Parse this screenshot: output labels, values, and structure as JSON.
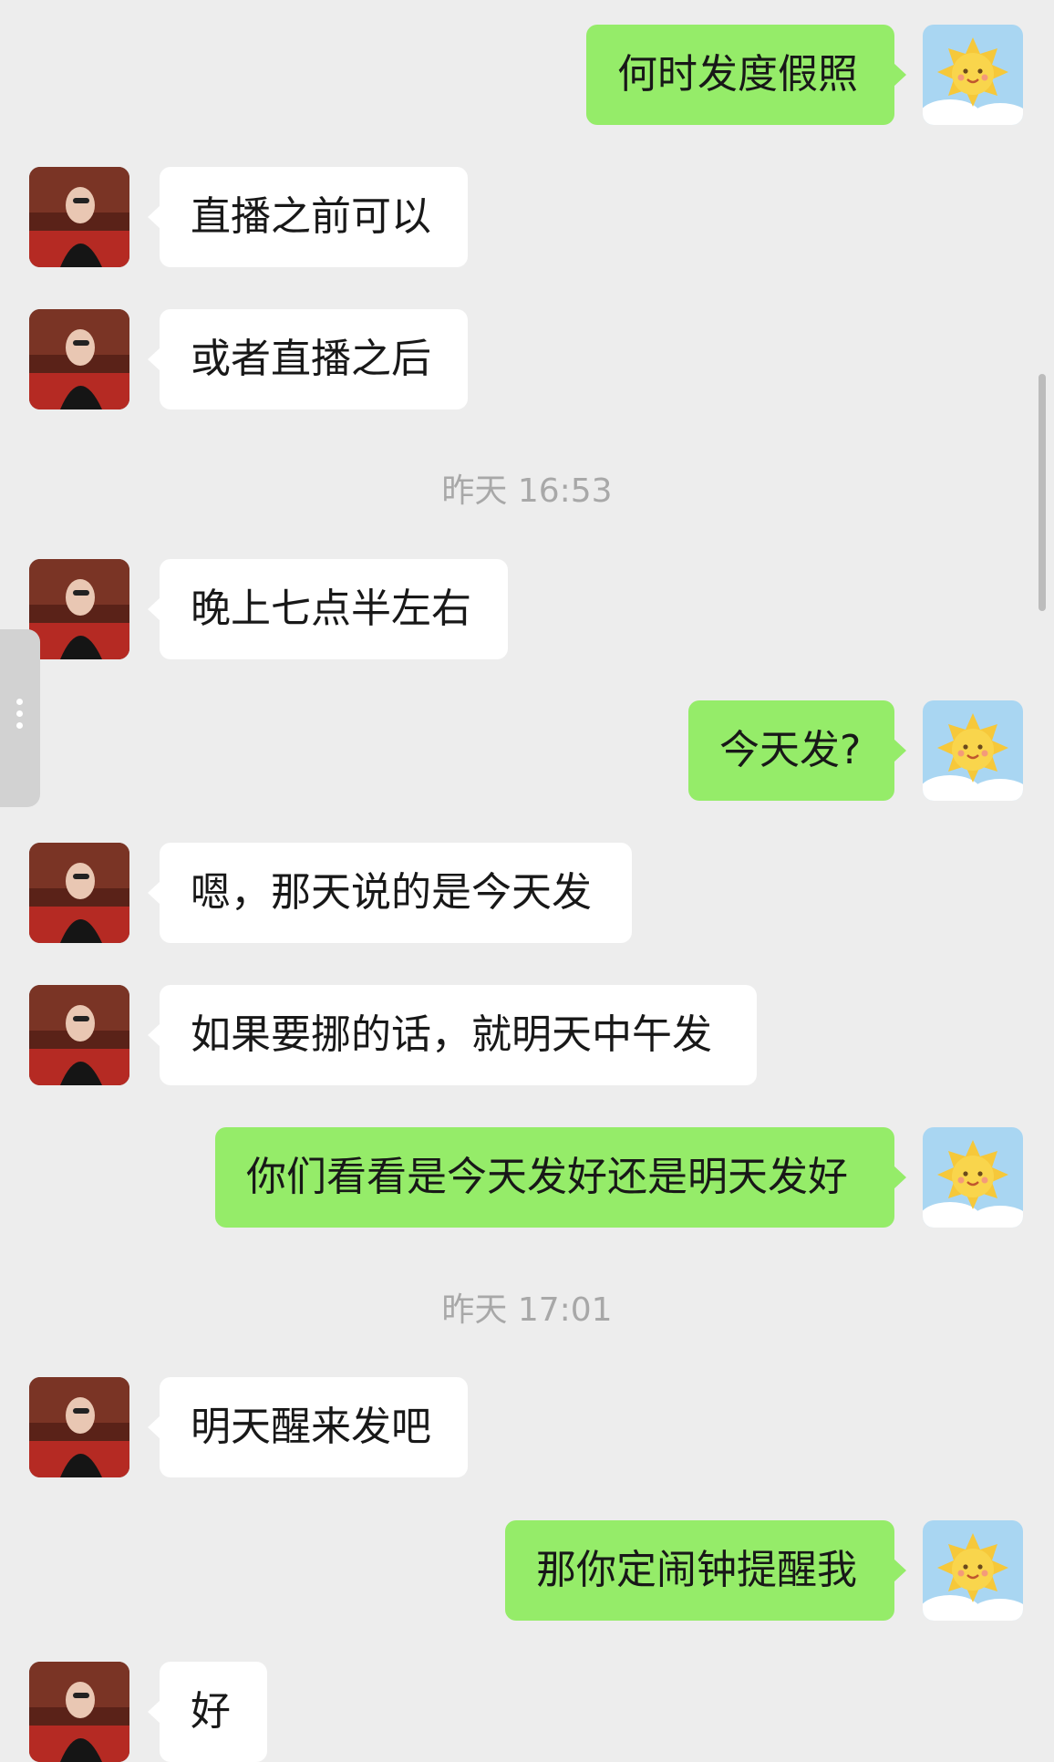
{
  "colors": {
    "background": "#ededed",
    "incoming_bubble": "#ffffff",
    "outgoing_bubble": "#95ec69",
    "timestamp_text": "#a8a8a8"
  },
  "messages": [
    {
      "type": "message",
      "direction": "out",
      "text": "何时发度假照",
      "avatar_icon": "sun-character-icon"
    },
    {
      "type": "message",
      "direction": "in",
      "text": "直播之前可以",
      "avatar_icon": "person-photo-icon"
    },
    {
      "type": "message",
      "direction": "in",
      "text": "或者直播之后",
      "avatar_icon": "person-photo-icon"
    },
    {
      "type": "timestamp",
      "text": "昨天 16:53"
    },
    {
      "type": "message",
      "direction": "in",
      "text": "晚上七点半左右",
      "avatar_icon": "person-photo-icon"
    },
    {
      "type": "message",
      "direction": "out",
      "text": "今天发?",
      "avatar_icon": "sun-character-icon"
    },
    {
      "type": "message",
      "direction": "in",
      "text": "嗯，那天说的是今天发",
      "avatar_icon": "person-photo-icon"
    },
    {
      "type": "message",
      "direction": "in",
      "text": "如果要挪的话，就明天中午发",
      "avatar_icon": "person-photo-icon"
    },
    {
      "type": "message",
      "direction": "out",
      "text": "你们看看是今天发好还是明天发好",
      "avatar_icon": "sun-character-icon"
    },
    {
      "type": "timestamp",
      "text": "昨天 17:01"
    },
    {
      "type": "message",
      "direction": "in",
      "text": "明天醒来发吧",
      "avatar_icon": "person-photo-icon"
    },
    {
      "type": "message",
      "direction": "out",
      "text": "那你定闹钟提醒我",
      "avatar_icon": "sun-character-icon"
    },
    {
      "type": "message",
      "direction": "in",
      "text": "好",
      "avatar_icon": "person-photo-icon"
    }
  ]
}
